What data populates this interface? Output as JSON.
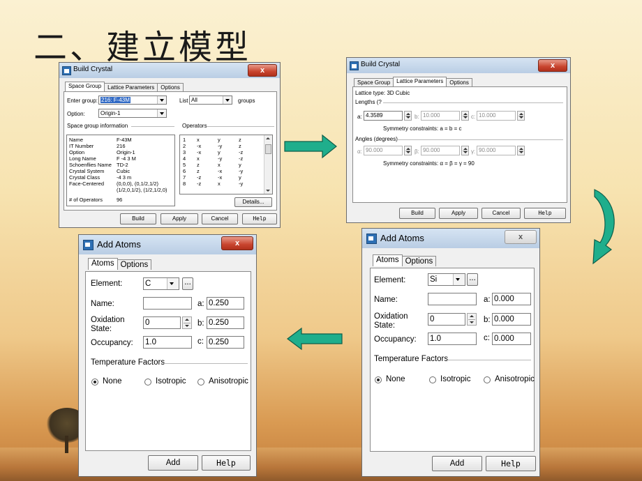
{
  "slide": {
    "title": "二、建立模型"
  },
  "build_crystal_1": {
    "title": "Build Crystal",
    "close": "x",
    "tabs": [
      "Space Group",
      "Lattice Parameters",
      "Options"
    ],
    "enter_group_label": "Enter group:",
    "enter_group_value": "216: F-43M",
    "list_label": "List",
    "list_value": "All",
    "groups_label": "groups",
    "option_label": "Option:",
    "option_value": "Origin-1",
    "sg_info_label": "Space group information",
    "operators_label": "Operators",
    "info": [
      {
        "k": "Name",
        "v": "F-43M"
      },
      {
        "k": "IT Number",
        "v": "216"
      },
      {
        "k": "Option",
        "v": "Origin-1"
      },
      {
        "k": "Long Name",
        "v": "F -4 3 M"
      },
      {
        "k": "Schoenflies Name",
        "v": "TD-2"
      },
      {
        "k": "Crystal System",
        "v": "Cubic"
      },
      {
        "k": "Crystal Class",
        "v": "-4 3 m"
      },
      {
        "k": "Face-Centered",
        "v": "(0,0,0), (0,1/2,1/2)"
      },
      {
        "k": "",
        "v": "(1/2,0,1/2), (1/2,1/2,0)"
      },
      {
        "k": "# of Operators",
        "v": "96"
      }
    ],
    "operators": [
      [
        "1",
        "x",
        "y",
        "z"
      ],
      [
        "2",
        "-x",
        "-y",
        "z"
      ],
      [
        "3",
        "-x",
        "y",
        "-z"
      ],
      [
        "4",
        "x",
        "-y",
        "-z"
      ],
      [
        "5",
        "z",
        "x",
        "y"
      ],
      [
        "6",
        "z",
        "-x",
        "-y"
      ],
      [
        "7",
        "-z",
        "-x",
        "y"
      ],
      [
        "8",
        "-z",
        "x",
        "-y"
      ]
    ],
    "details_btn": "Details...",
    "buttons": {
      "build": "Build",
      "apply": "Apply",
      "cancel": "Cancel",
      "help": "Help"
    }
  },
  "build_crystal_2": {
    "title": "Build Crystal",
    "close": "x",
    "tabs": [
      "Space Group",
      "Lattice Parameters",
      "Options"
    ],
    "lattice_type": "Lattice type:  3D Cubic",
    "lengths_label": "Lengths (?",
    "a_label": "a:",
    "a_value": "4.3589",
    "b_label": "b:",
    "b_value": "10.000",
    "c_label": "c:",
    "c_value": "10.000",
    "sym_lengths": "Symmetry constraints:     a = b = c",
    "angles_label": "Angles (degrees)",
    "alpha_label": "α:",
    "alpha_value": "90.000",
    "beta_label": "β:",
    "beta_value": "90.000",
    "gamma_label": "γ:",
    "gamma_value": "90.000",
    "sym_angles": "Symmetry constraints:    α = β = γ = 90",
    "buttons": {
      "build": "Build",
      "apply": "Apply",
      "cancel": "Cancel",
      "help": "Help"
    }
  },
  "add_atoms_c": {
    "title": "Add Atoms",
    "close": "x",
    "tabs": [
      "Atoms",
      "Options"
    ],
    "element_label": "Element:",
    "element_value": "C",
    "name_label": "Name:",
    "name_value": "",
    "a_label": "a:",
    "a_value": "0.250",
    "ox_label_1": "Oxidation",
    "ox_label_2": "State:",
    "ox_value": "0",
    "b_label": "b:",
    "b_value": "0.250",
    "occ_label": "Occupancy:",
    "occ_value": "1.0",
    "c_label": "c:",
    "c_value": "0.250",
    "temp_label": "Temperature Factors",
    "radios": [
      "None",
      "Isotropic",
      "Anisotropic"
    ],
    "radio_selected": "None",
    "buttons": {
      "add": "Add",
      "help": "Help"
    },
    "ellipsis": "..."
  },
  "add_atoms_si": {
    "title": "Add Atoms",
    "close": "x",
    "tabs": [
      "Atoms",
      "Options"
    ],
    "element_label": "Element:",
    "element_value": "Si",
    "name_label": "Name:",
    "name_value": "",
    "a_label": "a:",
    "a_value": "0.000",
    "ox_label_1": "Oxidation",
    "ox_label_2": "State:",
    "ox_value": "0",
    "b_label": "b:",
    "b_value": "0.000",
    "occ_label": "Occupancy:",
    "occ_value": "1.0",
    "c_label": "c:",
    "c_value": "0.000",
    "temp_label": "Temperature Factors",
    "radios": [
      "None",
      "Isotropic",
      "Anisotropic"
    ],
    "radio_selected": "None",
    "buttons": {
      "add": "Add",
      "help": "Help"
    },
    "ellipsis": "..."
  },
  "colors": {
    "arrow_fill": "#1fae8c",
    "arrow_stroke": "#0d5e4a"
  }
}
